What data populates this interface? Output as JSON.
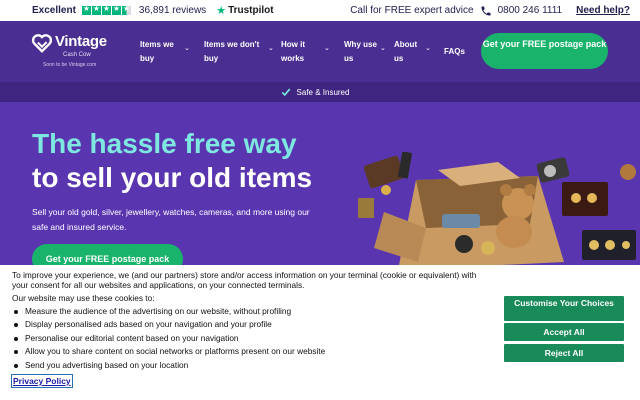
{
  "topbar": {
    "rating_word": "Excellent",
    "stars": 4.5,
    "review_count": "36,891 reviews",
    "trustpilot": "Trustpilot",
    "call_text": "Call for FREE expert advice",
    "phone": "0800 246 1111",
    "help": "Need help?"
  },
  "nav": {
    "logo_name": "Vintage",
    "logo_sub": "Cash Cow",
    "logo_soon": "Soon to be Vintage.com",
    "items": [
      {
        "label": "Items we buy"
      },
      {
        "label": "Items we don't buy"
      },
      {
        "label": "How it works"
      },
      {
        "label": "Why use us"
      },
      {
        "label": "About us"
      },
      {
        "label": "FAQs"
      }
    ],
    "cta": "Get your FREE postage pack"
  },
  "safe_strip": {
    "text": "Safe & Insured"
  },
  "hero": {
    "title_line1": "The hassle free way",
    "title_line2": "to sell your old items",
    "description": "Sell your old gold, silver, jewellery, watches, cameras, and more using our safe and insured service.",
    "cta": "Get your FREE postage pack"
  },
  "cookie": {
    "intro": "To improve your experience, we (and our partners) store and/or access information on your terminal (cookie or equivalent) with your consent for all our websites and applications, on your connected terminals.",
    "may_use": "Our website may use these cookies to:",
    "purposes": [
      "Measure the audience of the advertising on our website, without profiling",
      "Display personalised ads based on your navigation and your profile",
      "Personalise our editorial content based on your navigation",
      "Allow you to share content on social networks or platforms present on our website",
      "Send you advertising based on your location"
    ],
    "privacy_policy": "Privacy Policy",
    "customise": "Customise Your Choices",
    "accept": "Accept All",
    "reject": "Reject All"
  },
  "colors": {
    "brand_purple": "#4b2e91",
    "hero_purple": "#5a35b0",
    "accent_teal": "#7ee8e0",
    "cta_green": "#19b36b",
    "trustpilot_green": "#00b67a",
    "cookie_button_green": "#198a59"
  }
}
